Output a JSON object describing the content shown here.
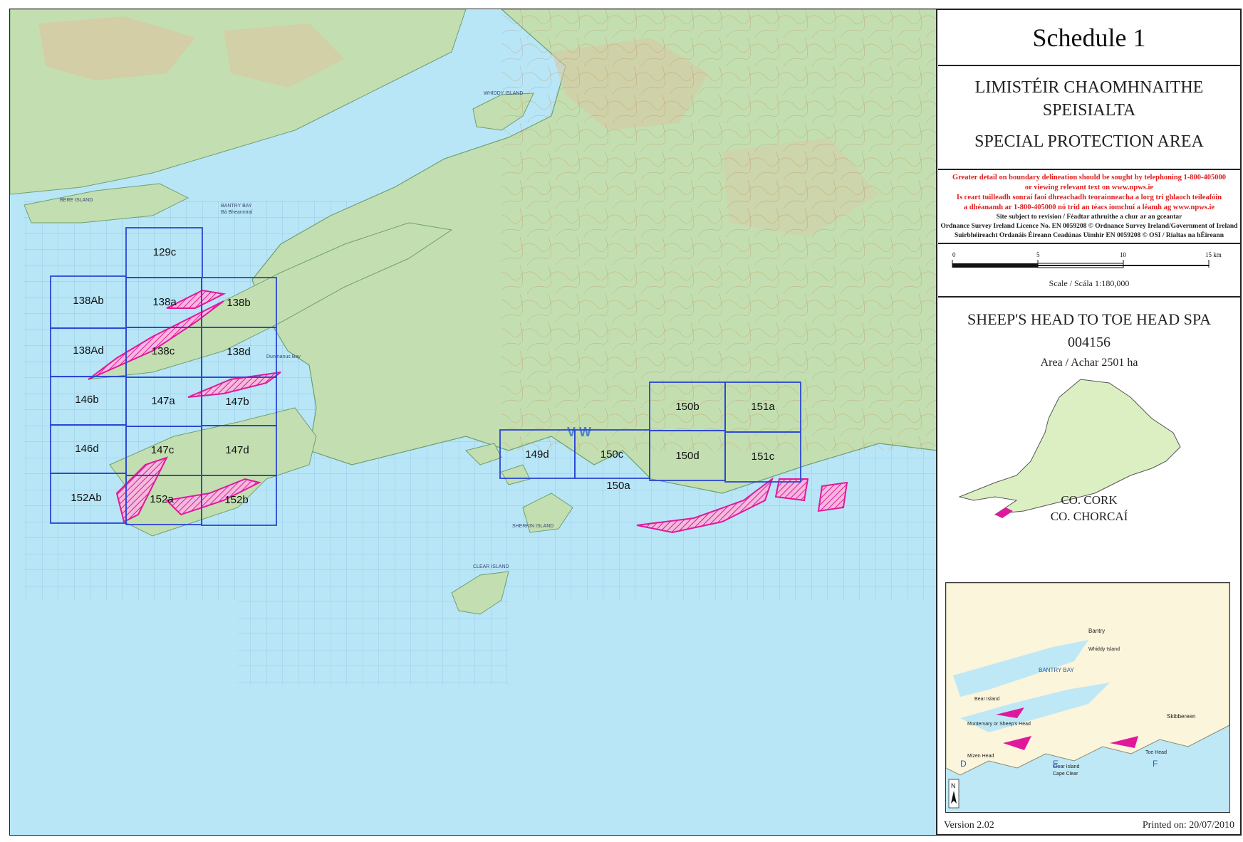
{
  "map": {
    "tiles": [
      {
        "label": "129c"
      },
      {
        "label": "138Ab"
      },
      {
        "label": "138a"
      },
      {
        "label": "138b"
      },
      {
        "label": "138Ad"
      },
      {
        "label": "138c"
      },
      {
        "label": "138d"
      },
      {
        "label": "146b"
      },
      {
        "label": "147a"
      },
      {
        "label": "147b"
      },
      {
        "label": "146d"
      },
      {
        "label": "147c"
      },
      {
        "label": "147d"
      },
      {
        "label": "152Ab"
      },
      {
        "label": "152a"
      },
      {
        "label": "152b"
      },
      {
        "label": "149d"
      },
      {
        "label": "150c"
      },
      {
        "label": "150a"
      },
      {
        "label": "150b"
      },
      {
        "label": "150d"
      },
      {
        "label": "151a"
      },
      {
        "label": "151c"
      }
    ],
    "places": {
      "whiddy_island": "WHIDDY ISLAND",
      "bantry_bay": "BANTRY BAY",
      "bantry_bay_ga": "Bá Bheanntraí",
      "clear_island": "CLEAR ISLAND",
      "sherkin_island": "SHERKIN ISLAND",
      "grid_letters": "V W",
      "bere_island": "BERE ISLAND",
      "dunmanus_bay": "Dunmanus Bay"
    },
    "colors": {
      "sea": "#b8e6f7",
      "land": "#c3dfb1",
      "upland": "#d7c9a3",
      "tile_outline": "#2a46d4",
      "spa_boundary": "#e0199c",
      "grid": "#7fb6df"
    }
  },
  "panel": {
    "title": "Schedule 1",
    "designation_ga_line1": "LIMISTÉIR CHAOMHNAITHE",
    "designation_ga_line2": "SPEISIALTA",
    "designation_en": "SPECIAL PROTECTION AREA",
    "notes": {
      "en_line1": "Greater detail on boundary delineation should be sought by telephoning 1-800-405000",
      "en_line2": "or viewing relevant text on www.npws.ie",
      "ga_line1": "Is ceart tuilleadh sonraí faoi dhreachadh teorainneacha a lorg trí ghlaoch teileafóin",
      "ga_line2": "a dhéanamh ar 1-800-405000 nó tríd an téacs iomchuí a léamh ag www.npws.ie",
      "revision": "Site subject to revision / Féadtar athruithe a chur ar an gceantar",
      "licence_en": "Ordnance Survey Ireland Licence No. EN 0059208 © Ordnance Survey Ireland/Government of Ireland",
      "licence_ga": "Suirbhéireacht Ordanáis Éireann Ceadúnas Uimhir EN 0059208 © OSI / Rialtas na hÉireann"
    },
    "scale": {
      "ticks": [
        "0",
        "5",
        "10",
        "15 km"
      ],
      "label": "Scale / Scála 1:180,000"
    },
    "site": {
      "name": "SHEEP'S HEAD TO TOE HEAD SPA",
      "code": "004156",
      "area": "Area / Achar 2501 ha"
    },
    "county": {
      "en": "CO. CORK",
      "ga": "CO. CHORCAÍ"
    },
    "inset": {
      "places": {
        "bantry": "Bantry",
        "bantry_bay": "BANTRY BAY",
        "muntervary": "Muntervary or Sheep's Head",
        "mizen_head": "Mizen Head",
        "clear_island": "Clear Island",
        "cape_clear": "Cape Clear",
        "skibbereen": "Skibbereen",
        "toe_head": "Toe Head",
        "bear_island": "Bear Island",
        "whiddy": "Whiddy Island"
      },
      "grid_letters": [
        "D",
        "E",
        "F"
      ],
      "north": "N"
    },
    "footer": {
      "version": "Version 2.02",
      "printed": "Printed on: 20/07/2010"
    }
  }
}
